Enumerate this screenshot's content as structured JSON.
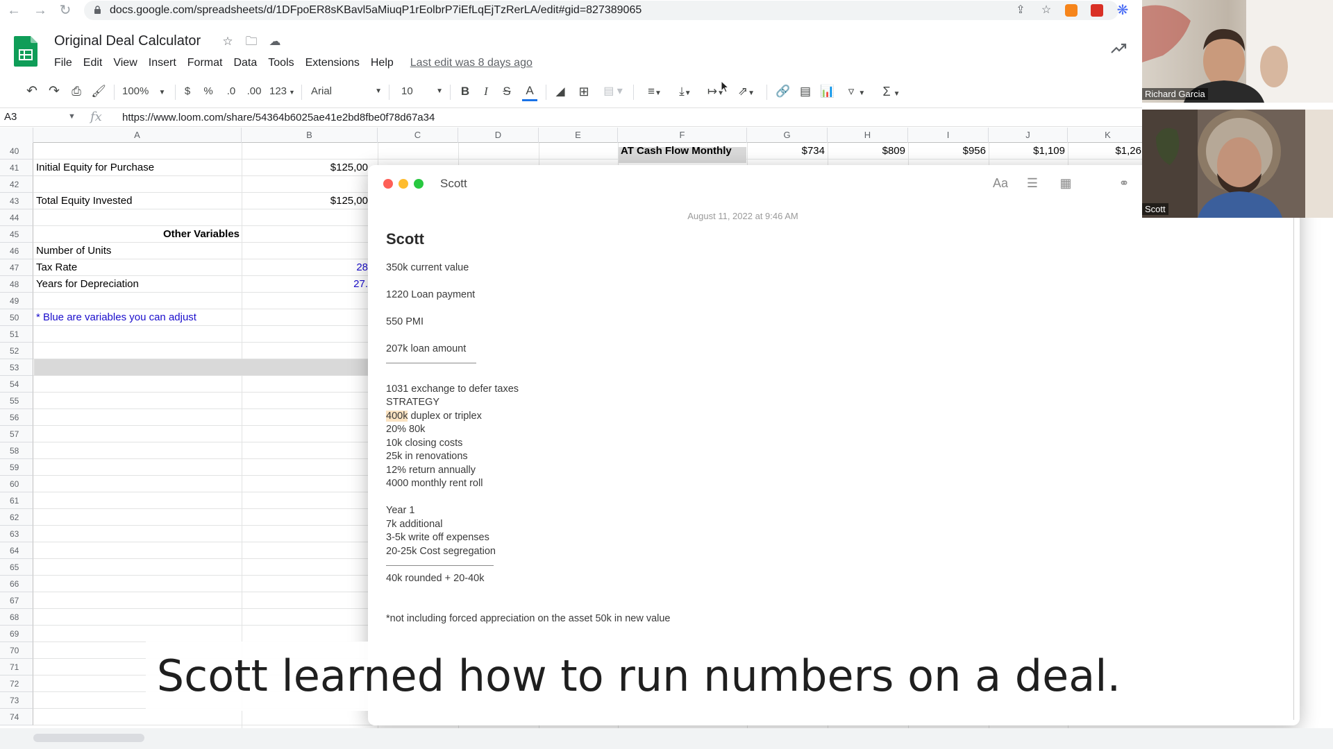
{
  "browser": {
    "url": "docs.google.com/spreadsheets/d/1DFpoER8sKBavl5aMiuqP1rEolbrP7iEfLqEjTzRerLA/edit#gid=827389065"
  },
  "sheets": {
    "title": "Original Deal Calculator",
    "menu": [
      "File",
      "Edit",
      "View",
      "Insert",
      "Format",
      "Data",
      "Tools",
      "Extensions",
      "Help"
    ],
    "last_edit": "Last edit was 8 days ago",
    "toolbar": {
      "zoom": "100%",
      "currency": "$",
      "percent": "%",
      "dec_decrease": ".0",
      "dec_increase": ".00",
      "more_formats": "123",
      "font": "Arial",
      "font_size": "10",
      "bold": "B",
      "italic": "I",
      "strike": "S",
      "text_color": "A"
    },
    "name_box": "A3",
    "formula": "https://www.loom.com/share/54364b6025ae41e2bd8fbe0f78d67a34",
    "columns": [
      "A",
      "B",
      "C",
      "D",
      "E",
      "F",
      "G",
      "H",
      "I",
      "J",
      "K"
    ],
    "rows": [
      "40",
      "41",
      "42",
      "43",
      "44",
      "45",
      "46",
      "47",
      "48",
      "49",
      "50",
      "51",
      "52",
      "53",
      "54",
      "55",
      "56",
      "57",
      "58",
      "59",
      "60",
      "61",
      "62",
      "63",
      "64",
      "65",
      "66",
      "67",
      "68",
      "69",
      "70",
      "71",
      "72",
      "73",
      "74"
    ],
    "cells": {
      "r41_a": "Initial Equity for Purchase",
      "r41_b": "$125,00",
      "r43_a": "Total Equity Invested",
      "r43_b": "$125,00",
      "r45_a": "Other Variables",
      "r46_a": "Number of Units",
      "r47_a": "Tax Rate",
      "r47_b": "28",
      "r48_a": "Years for Depreciation",
      "r48_b": "27.",
      "r50_a": "* Blue are variables you can adjust",
      "r40_f": "AT Cash Flow Monthly",
      "r40_g": "$734",
      "r40_h": "$809",
      "r40_i": "$956",
      "r40_j": "$1,109",
      "r40_k": "$1,26"
    }
  },
  "notes": {
    "window_title": "Scott",
    "font_tool": "Aa",
    "date": "August 11, 2022 at 9:46 AM",
    "heading": "Scott",
    "lines": {
      "l1": "350k current value",
      "l2": "1220 Loan payment",
      "l3": "550 PMI",
      "l4": "207k loan amount",
      "l5": "1031 exchange to defer taxes",
      "l6": "STRATEGY",
      "l7_hl": "400k",
      "l7_rest": " duplex or triplex",
      "l8": "20% 80k",
      "l9": "10k closing costs",
      "l10": "25k in renovations",
      "l11": "12% return annually",
      "l12": "4000 monthly rent roll",
      "l13": "Year 1",
      "l14": "7k additional",
      "l15": "3-5k write off expenses",
      "l16": "20-25k Cost segregation",
      "l17": "40k rounded + 20-40k",
      "l18": "*not including forced appreciation on the asset 50k in new value"
    }
  },
  "video": {
    "tile1_name": "Richard Garcia",
    "tile2_name": "Scott"
  },
  "caption": "Scott learned how to run numbers on a deal."
}
